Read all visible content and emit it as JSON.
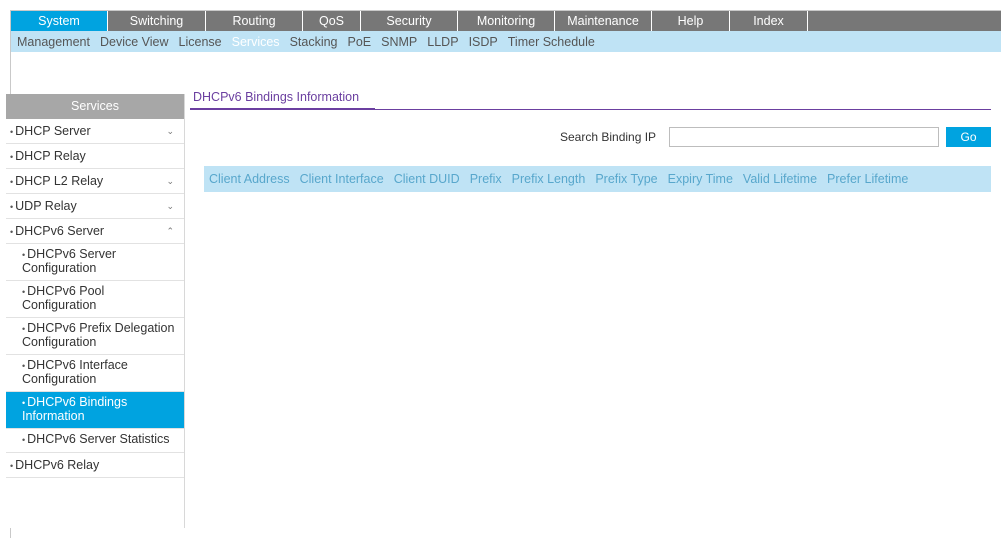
{
  "top_nav": [
    "System",
    "Switching",
    "Routing",
    "QoS",
    "Security",
    "Monitoring",
    "Maintenance",
    "Help",
    "Index"
  ],
  "sub_nav": [
    "Management",
    "Device View",
    "License",
    "Services",
    "Stacking",
    "PoE",
    "SNMP",
    "LLDP",
    "ISDP",
    "Timer Schedule"
  ],
  "active_top": "System",
  "active_sub": "Services",
  "sidebar": {
    "header": "Services",
    "dhcp_server": "DHCP Server",
    "dhcp_relay": "DHCP Relay",
    "dhcp_l2_relay": "DHCP L2 Relay",
    "udp_relay": "UDP Relay",
    "dhcpv6_server": "DHCPv6 Server",
    "sub": {
      "server_config": "DHCPv6 Server Configuration",
      "pool_config": "DHCPv6 Pool Configuration",
      "prefix_delegation": "DHCPv6 Prefix Delegation Configuration",
      "interface_config": "DHCPv6 Interface Configuration",
      "bindings_info": "DHCPv6 Bindings Information",
      "server_stats": "DHCPv6 Server Statistics"
    },
    "dhcpv6_relay": "DHCPv6 Relay"
  },
  "content": {
    "title": "DHCPv6 Bindings Information",
    "search_label": "Search Binding IP",
    "search_value": "",
    "go_label": "Go"
  },
  "table_columns": [
    "Client Address",
    "Client Interface",
    "Client DUID",
    "Prefix",
    "Prefix Length",
    "Prefix Type",
    "Expiry Time",
    "Valid Lifetime",
    "Prefer Lifetime"
  ]
}
